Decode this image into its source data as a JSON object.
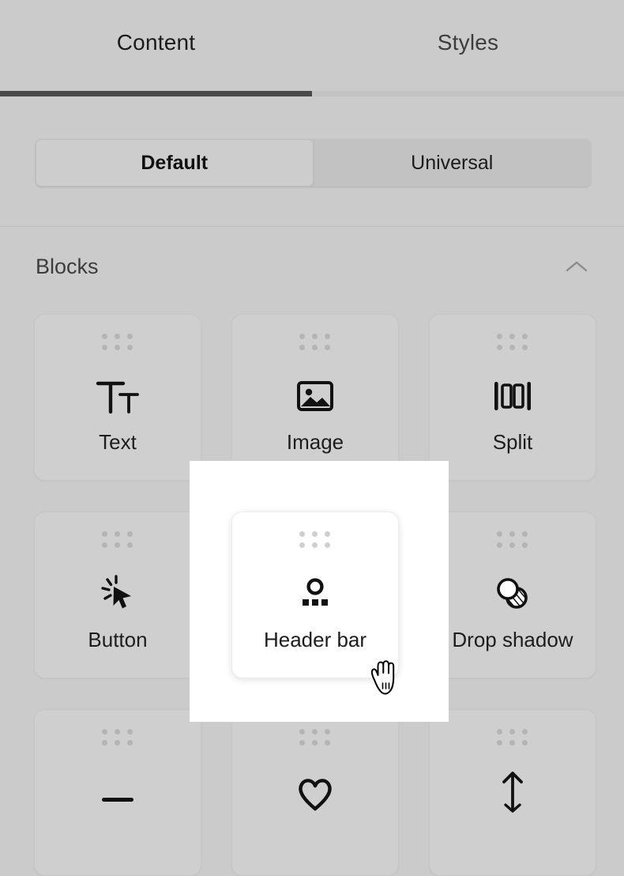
{
  "tabs": [
    {
      "label": "Content",
      "active": true
    },
    {
      "label": "Styles",
      "active": false
    }
  ],
  "segmented": {
    "options": [
      {
        "label": "Default",
        "selected": true
      },
      {
        "label": "Universal",
        "selected": false
      }
    ]
  },
  "section": {
    "title": "Blocks",
    "collapse_icon": "chevron-up-icon",
    "expanded": true
  },
  "blocks": [
    {
      "label": "Text",
      "icon": "text-format-icon",
      "highlighted": false
    },
    {
      "label": "Image",
      "icon": "image-icon",
      "highlighted": false
    },
    {
      "label": "Split",
      "icon": "split-columns-icon",
      "highlighted": false
    },
    {
      "label": "Button",
      "icon": "cursor-click-icon",
      "highlighted": false
    },
    {
      "label": "Header bar",
      "icon": "header-bar-icon",
      "highlighted": true
    },
    {
      "label": "Drop shadow",
      "icon": "drop-shadow-icon",
      "highlighted": false
    },
    {
      "label": "",
      "icon": "divider-line-icon",
      "highlighted": false
    },
    {
      "label": "",
      "icon": "heart-icon",
      "highlighted": false
    },
    {
      "label": "",
      "icon": "arrow-up-icon",
      "highlighted": false
    }
  ],
  "cursor": {
    "type": "grab-hand-cursor"
  },
  "colors": {
    "background": "#cbcbcb",
    "card": "#cfcfcf",
    "card_highlight": "#ffffff",
    "tab_indicator": "#4a4a4a",
    "text": "#1d1d1d",
    "muted_text": "#3c3c3c",
    "drag_dot": "#b4b4b4"
  }
}
